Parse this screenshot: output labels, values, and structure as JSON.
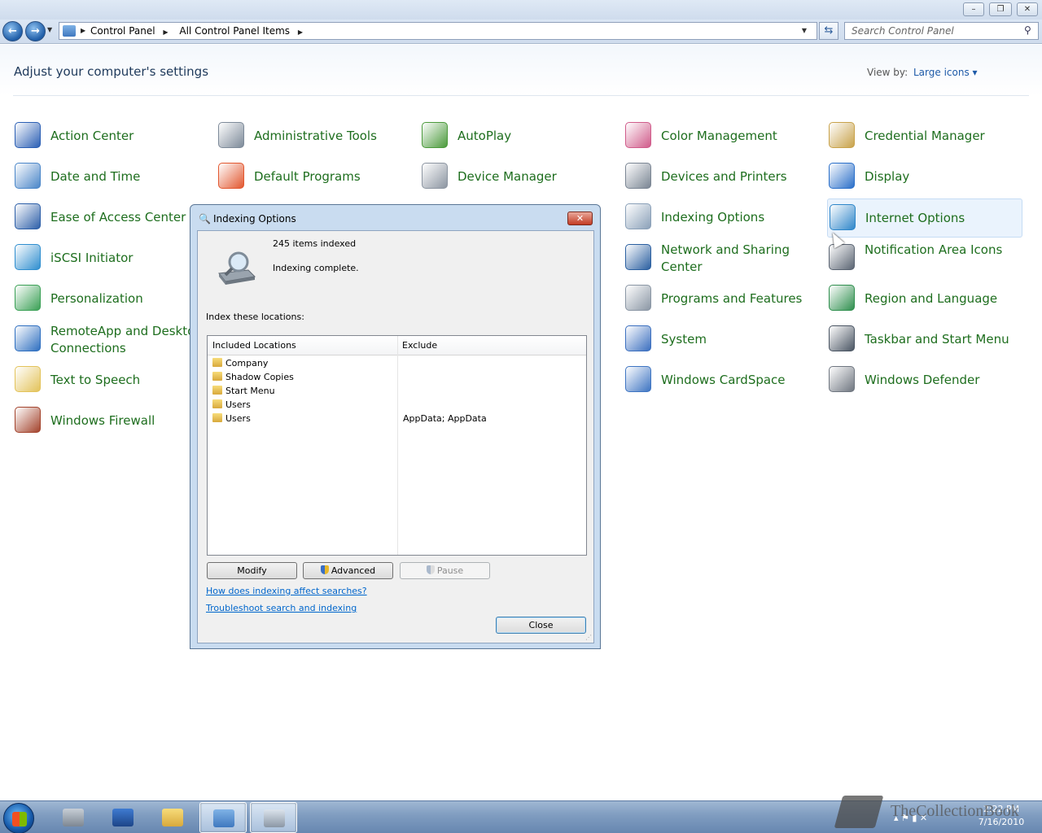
{
  "window": {
    "minimize": "–",
    "restore": "❐",
    "close": "✕"
  },
  "nav": {
    "back": "←",
    "forward": "→",
    "refresh": "⇆",
    "breadcrumb": [
      "Control Panel",
      "All Control Panel Items"
    ],
    "search_placeholder": "Search Control Panel"
  },
  "header": {
    "title": "Adjust your computer's settings",
    "view_by_label": "View by:",
    "view_by_value": "Large icons ▾"
  },
  "items": [
    {
      "label": "Action Center",
      "icon": "flag-icon",
      "color": "#2b5fb4"
    },
    {
      "label": "Administrative Tools",
      "icon": "gears-checklist-icon",
      "color": "#7d8a99"
    },
    {
      "label": "AutoPlay",
      "icon": "autoplay-icon",
      "color": "#4b9a3b"
    },
    {
      "label": "Color Management",
      "icon": "color-monitor-icon",
      "color": "#d05b8a"
    },
    {
      "label": "Credential Manager",
      "icon": "vault-icon",
      "color": "#c8a24a"
    },
    {
      "label": "Date and Time",
      "icon": "calendar-clock-icon",
      "color": "#4a86c8"
    },
    {
      "label": "Default Programs",
      "icon": "windows-check-icon",
      "color": "#e2572f"
    },
    {
      "label": "Device Manager",
      "icon": "device-manager-icon",
      "color": "#8c95a1"
    },
    {
      "label": "Devices and Printers",
      "icon": "printer-icon",
      "color": "#7a8593"
    },
    {
      "label": "Display",
      "icon": "display-monitor-icon",
      "color": "#2a6fc9"
    },
    {
      "label": "Ease of Access Center",
      "icon": "ease-of-access-icon",
      "color": "#2d5fa8"
    },
    {
      "label": "",
      "icon": "",
      "color": ""
    },
    {
      "label": "",
      "icon": "",
      "color": ""
    },
    {
      "label": "Indexing Options",
      "icon": "indexing-magnifier-icon",
      "color": "#8aa0b8"
    },
    {
      "label": "Internet Options",
      "icon": "globe-checklist-icon",
      "color": "#2e86c9"
    },
    {
      "label": "iSCSI Initiator",
      "icon": "globe-shield-icon",
      "color": "#2f8ecf"
    },
    {
      "label": "",
      "icon": "",
      "color": ""
    },
    {
      "label": "",
      "icon": "",
      "color": ""
    },
    {
      "label": "Network and Sharing Center",
      "icon": "network-icon",
      "color": "#2a5fa0"
    },
    {
      "label": "Notification Area Icons",
      "icon": "notification-tray-icon",
      "color": "#5a6472"
    },
    {
      "label": "Personalization",
      "icon": "personalization-icon",
      "color": "#3aa055"
    },
    {
      "label": "",
      "icon": "",
      "color": ""
    },
    {
      "label": "",
      "icon": "",
      "color": ""
    },
    {
      "label": "Programs and Features",
      "icon": "programs-box-icon",
      "color": "#8a96a4"
    },
    {
      "label": "Region and Language",
      "icon": "globe-clock-icon",
      "color": "#2f8f4e"
    },
    {
      "label": "RemoteApp and Desktop Connections",
      "icon": "remote-desktop-icon",
      "color": "#2e6fc0"
    },
    {
      "label": "",
      "icon": "",
      "color": ""
    },
    {
      "label": "",
      "icon": "",
      "color": ""
    },
    {
      "label": "System",
      "icon": "system-monitor-icon",
      "color": "#3b6fbf"
    },
    {
      "label": "Taskbar and Start Menu",
      "icon": "taskbar-icon",
      "color": "#4a5563"
    },
    {
      "label": "Text to Speech",
      "icon": "speech-bubble-icon",
      "color": "#e3c35a"
    },
    {
      "label": "",
      "icon": "",
      "color": ""
    },
    {
      "label": "",
      "icon": "",
      "color": ""
    },
    {
      "label": "Windows CardSpace",
      "icon": "cardspace-icon",
      "color": "#3d74c2"
    },
    {
      "label": "Windows Defender",
      "icon": "defender-wall-icon",
      "color": "#6f7680"
    },
    {
      "label": "Windows Firewall",
      "icon": "firewall-icon",
      "color": "#a3432c"
    }
  ],
  "dialog": {
    "title": "Indexing Options",
    "items_indexed": "245 items indexed",
    "status": "Indexing complete.",
    "locations_label": "Index these locations:",
    "columns": [
      "Included Locations",
      "Exclude"
    ],
    "rows": [
      {
        "location": "Company",
        "exclude": ""
      },
      {
        "location": "Shadow Copies",
        "exclude": ""
      },
      {
        "location": "Start Menu",
        "exclude": ""
      },
      {
        "location": "Users",
        "exclude": ""
      },
      {
        "location": "Users",
        "exclude": "AppData; AppData"
      }
    ],
    "buttons": {
      "modify": "Modify",
      "advanced": "Advanced",
      "pause": "Pause",
      "close": "Close"
    },
    "links": [
      "How does indexing affect searches?",
      "Troubleshoot search and indexing"
    ]
  },
  "taskbar": {
    "time": "2:22 PM",
    "date": "7/16/2010",
    "watermark": "TheCollectionBook",
    "apps": [
      "server-manager-icon",
      "powershell-icon",
      "explorer-icon",
      "control-panel-icon",
      "indexing-options-icon"
    ]
  }
}
